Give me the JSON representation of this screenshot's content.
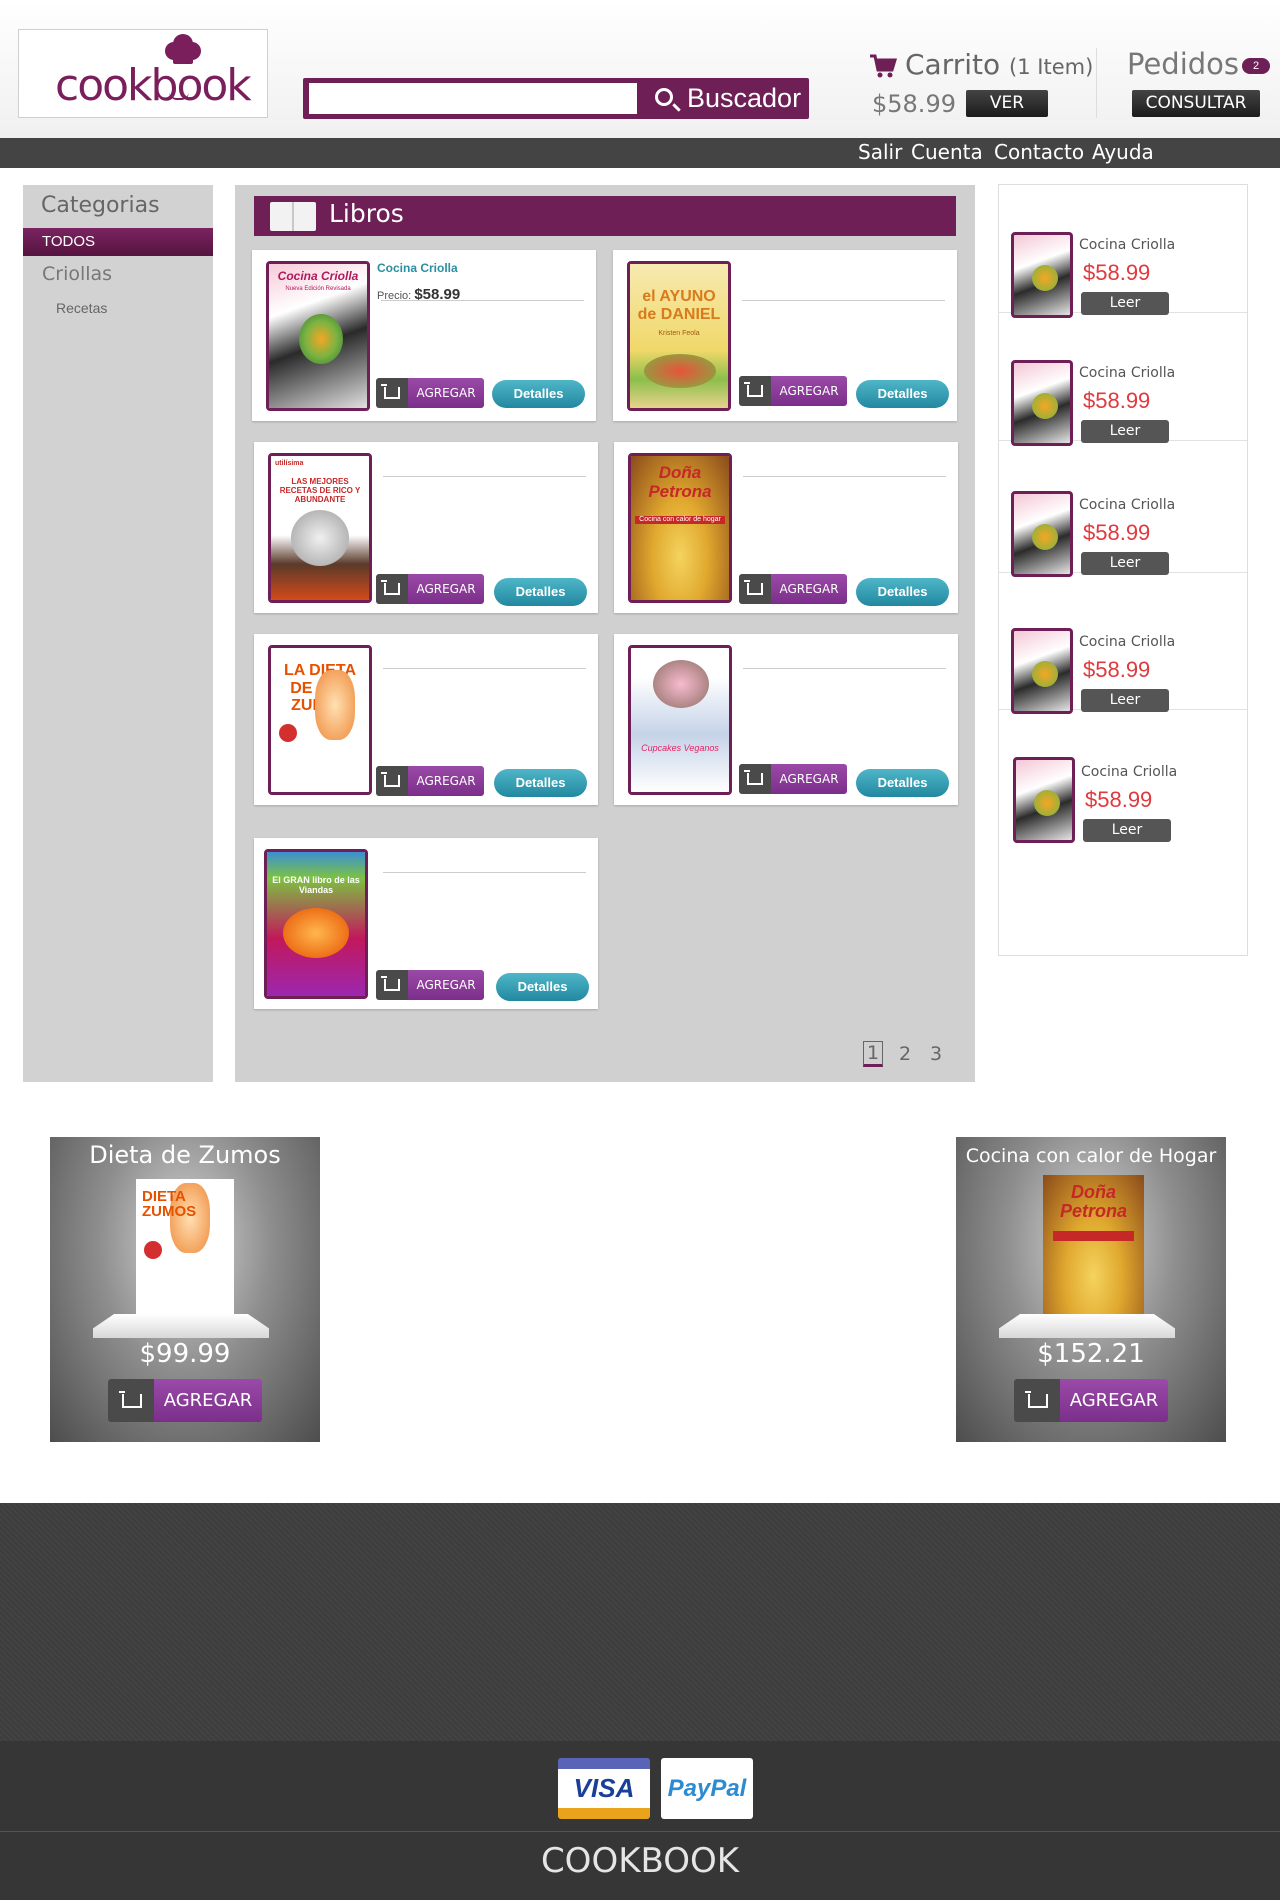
{
  "header": {
    "logo_text": "cookbook",
    "search": {
      "placeholder": "",
      "button_label": "Buscador"
    },
    "cart": {
      "title": "Carrito",
      "items_label": "(1 Item)",
      "total": "$58.99",
      "view_label": "VER"
    },
    "orders": {
      "title": "Pedidos",
      "badge": "2",
      "consult_label": "CONSULTAR"
    }
  },
  "nav": {
    "items": [
      "Salir",
      "Cuenta",
      "Contacto",
      "Ayuda"
    ]
  },
  "sidebar": {
    "title": "Categorias",
    "active": "TODOS",
    "items": [
      "Criollas"
    ],
    "subitems": [
      "Recetas"
    ]
  },
  "main": {
    "section_title": "Libros",
    "add_label": "AGREGAR",
    "details_label": "Detalles",
    "featured": {
      "title": "Cocina Criolla",
      "price_label": "Precio:",
      "price": "$58.99"
    },
    "products": [
      {
        "cover_title": "Cocina Criolla",
        "cover_subtitle": "Nueva Edición Revisada"
      },
      {
        "cover_title": "el AYUNO de DANIEL",
        "cover_subtitle": "Kristen Feola"
      },
      {
        "cover_title": "LAS MEJORES RECETAS DE RICO Y ABUNDANTE",
        "cover_subtitle": "utilísima"
      },
      {
        "cover_title": "Doña Petrona",
        "cover_subtitle": "Cocina con calor de hogar"
      },
      {
        "cover_title": "LA DIETA DE LOS ZUMOS",
        "cover_subtitle": ""
      },
      {
        "cover_title": "Cupcakes Veganos",
        "cover_subtitle": ""
      },
      {
        "cover_title": "El GRAN libro de las Viandas",
        "cover_subtitle": ""
      }
    ],
    "pages": [
      "1",
      "2",
      "3"
    ]
  },
  "right": {
    "items": [
      {
        "title": "Cocina Criolla",
        "price": "$58.99",
        "button": "Leer"
      },
      {
        "title": "Cocina Criolla",
        "price": "$58.99",
        "button": "Leer"
      },
      {
        "title": "Cocina Criolla",
        "price": "$58.99",
        "button": "Leer"
      },
      {
        "title": "Cocina Criolla",
        "price": "$58.99",
        "button": "Leer"
      },
      {
        "title": "Cocina Criolla",
        "price": "$58.99",
        "button": "Leer"
      }
    ]
  },
  "promos": [
    {
      "title": "Dieta de Zumos",
      "price": "$99.99",
      "button": "AGREGAR"
    },
    {
      "title": "Cocina con calor de Hogar",
      "price": "$152.21",
      "button": "AGREGAR"
    }
  ],
  "footer": {
    "visa": "VISA",
    "paypal": "PayPal",
    "brand": "COOKBOOK"
  },
  "colors": {
    "brand": "#6e1f55",
    "accent_purple": "#8a3a98",
    "details_teal": "#2a96ae",
    "price_red": "#e0393e"
  }
}
